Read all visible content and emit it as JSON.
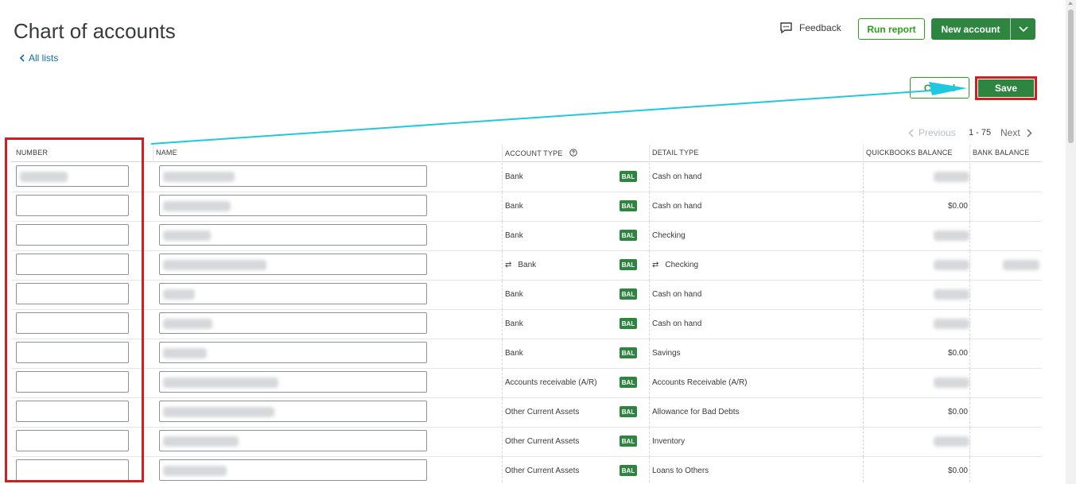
{
  "header": {
    "title": "Chart of accounts",
    "back_link": "All lists",
    "feedback_label": "Feedback",
    "run_report_label": "Run report",
    "new_account_label": "New account"
  },
  "edit_actions": {
    "cancel_label": "Cancel",
    "save_label": "Save"
  },
  "pagination": {
    "previous_label": "Previous",
    "range": "1 - 75",
    "next_label": "Next"
  },
  "columns": {
    "number": "NUMBER",
    "name": "NAME",
    "account_type": "ACCOUNT TYPE",
    "detail_type": "DETAIL TYPE",
    "quickbooks_balance": "QUICKBOOKS BALANCE",
    "bank_balance": "BANK BALANCE"
  },
  "badge_label": "BAL",
  "rows": [
    {
      "account_type": "Bank",
      "detail_type": "Cash on hand",
      "qb_balance": "",
      "linked": false
    },
    {
      "account_type": "Bank",
      "detail_type": "Cash on hand",
      "qb_balance": "$0.00",
      "linked": false
    },
    {
      "account_type": "Bank",
      "detail_type": "Checking",
      "qb_balance": "",
      "linked": false
    },
    {
      "account_type": "Bank",
      "detail_type": "Checking",
      "qb_balance": "",
      "linked": true
    },
    {
      "account_type": "Bank",
      "detail_type": "Cash on hand",
      "qb_balance": "",
      "linked": false
    },
    {
      "account_type": "Bank",
      "detail_type": "Cash on hand",
      "qb_balance": "",
      "linked": false
    },
    {
      "account_type": "Bank",
      "detail_type": "Savings",
      "qb_balance": "$0.00",
      "linked": false
    },
    {
      "account_type": "Accounts receivable (A/R)",
      "detail_type": "Accounts Receivable (A/R)",
      "qb_balance": "",
      "linked": false
    },
    {
      "account_type": "Other Current Assets",
      "detail_type": "Allowance for Bad Debts",
      "qb_balance": "$0.00",
      "linked": false
    },
    {
      "account_type": "Other Current Assets",
      "detail_type": "Inventory",
      "qb_balance": "",
      "linked": false
    },
    {
      "account_type": "Other Current Assets",
      "detail_type": "Loans to Others",
      "qb_balance": "$0.00",
      "linked": false
    }
  ],
  "colors": {
    "primary_green": "#2e8540",
    "outline_green": "#2ca01c",
    "link_blue": "#0d6dac",
    "annotation_red": "#d11f1f",
    "annotation_arrow": "#1ec8e0"
  }
}
